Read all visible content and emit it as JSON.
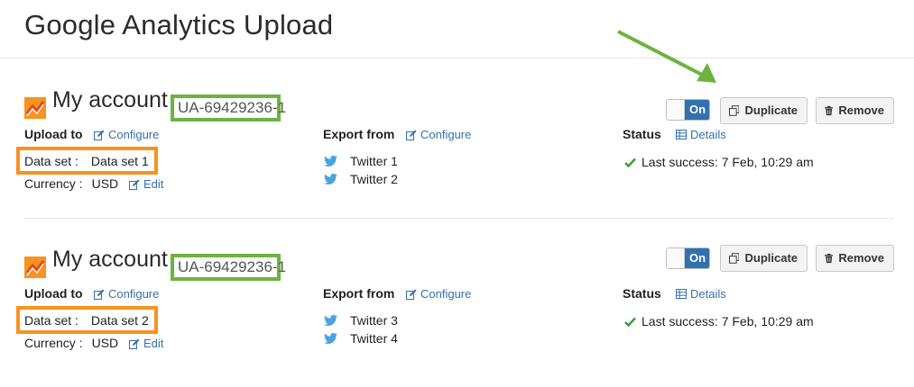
{
  "page": {
    "title": "Google Analytics Upload"
  },
  "accounts": [
    {
      "name": "My account",
      "property_id": "UA-69429236-1",
      "toggle_label": "On",
      "duplicate_label": "Duplicate",
      "remove_label": "Remove",
      "upload_to_label": "Upload to",
      "configure_label": "Configure",
      "dataset_key": "Data set :",
      "dataset_value": "Data set 1",
      "currency_key": "Currency :",
      "currency_value": "USD",
      "edit_label": "Edit",
      "export_from_label": "Export from",
      "export_configure_label": "Configure",
      "sources": [
        "Twitter 1",
        "Twitter 2"
      ],
      "status_label": "Status",
      "details_label": "Details",
      "status_text": "Last success: 7 Feb, 10:29 am"
    },
    {
      "name": "My account",
      "property_id": "UA-69429236-1",
      "toggle_label": "On",
      "duplicate_label": "Duplicate",
      "remove_label": "Remove",
      "upload_to_label": "Upload to",
      "configure_label": "Configure",
      "dataset_key": "Data set :",
      "dataset_value": "Data set 2",
      "currency_key": "Currency :",
      "currency_value": "USD",
      "edit_label": "Edit",
      "export_from_label": "Export from",
      "export_configure_label": "Configure",
      "sources": [
        "Twitter 3",
        "Twitter 4"
      ],
      "status_label": "Status",
      "details_label": "Details",
      "status_text": "Last success: 7 Feb, 10:29 am"
    }
  ],
  "icons": {
    "account": "analytics-chart-icon",
    "duplicate": "copy-icon",
    "remove": "trash-icon",
    "configure": "edit-icon",
    "details": "table-icon",
    "source": "twitter-bird-icon",
    "status": "check-icon"
  },
  "colors": {
    "link": "#3370b0",
    "toggle_on": "#3370b0",
    "property_highlight": "#6cb33f",
    "dataset_highlight": "#f7931e",
    "success": "#3a9a3a",
    "twitter": "#4aa3df",
    "annotation_arrow": "#6cb33f"
  }
}
